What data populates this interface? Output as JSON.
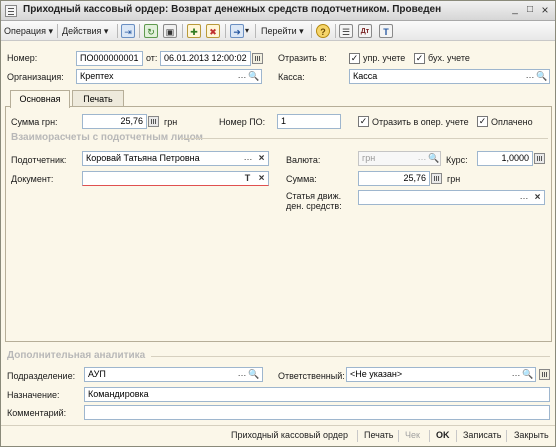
{
  "window": {
    "title": "Приходный кассовый ордер: Возврат денежных средств подотчетником. Проведен",
    "minimize": "_",
    "maximize": "□",
    "close": "×"
  },
  "toolbar": {
    "operation": "Операция ▾",
    "actions": "Действия ▾",
    "goto": "Перейти ▾",
    "help_icon": "?"
  },
  "header": {
    "number_label": "Номер:",
    "number_value": "ПО000000001",
    "from_label": "от:",
    "date_value": "06.01.2013 12:00:02",
    "reflect_label": "Отразить в:",
    "mgmt_label": "упр. учете",
    "acc_label": "бух. учете",
    "org_label": "Организация:",
    "org_value": "Крептех",
    "cash_label": "Касса:",
    "cash_value": "Касса"
  },
  "tabs": [
    {
      "label": "Основная"
    },
    {
      "label": "Печать"
    }
  ],
  "main": {
    "sum_label": "Сумма грн:",
    "sum_value": "25,76",
    "sum_unit": "грн",
    "po_label": "Номер ПО:",
    "po_value": "1",
    "oper_label": "Отразить в опер. учете",
    "paid_label": "Оплачено",
    "section_title": "Взаиморасчеты с подотчетным лицом",
    "acc_person_label": "Подотчетник:",
    "acc_person_value": "Коровай Татьяна Петровна",
    "doc_label": "Документ:",
    "doc_value": "",
    "currency_label": "Валюта:",
    "currency_value": "грн",
    "rate_label": "Курс:",
    "rate_value": "1,0000",
    "amount_label": "Сумма:",
    "amount_value": "25,76",
    "amount_unit": "грн",
    "flow_label_1": "Статья движ.",
    "flow_label_2": "ден. средств:",
    "flow_value": ""
  },
  "extra": {
    "section_title": "Дополнительная аналитика",
    "dept_label": "Подразделение:",
    "dept_value": "АУП",
    "resp_label": "Ответственный:",
    "resp_value": "<Не указан>",
    "purpose_label": "Назначение:",
    "purpose_value": "Командировка",
    "comment_label": "Комментарий:",
    "comment_value": ""
  },
  "status": {
    "doc_type": "Приходный кассовый ордер",
    "print": "Печать",
    "check": "Чек",
    "ok": "OK",
    "save": "Записать",
    "close": "Закрыть"
  }
}
